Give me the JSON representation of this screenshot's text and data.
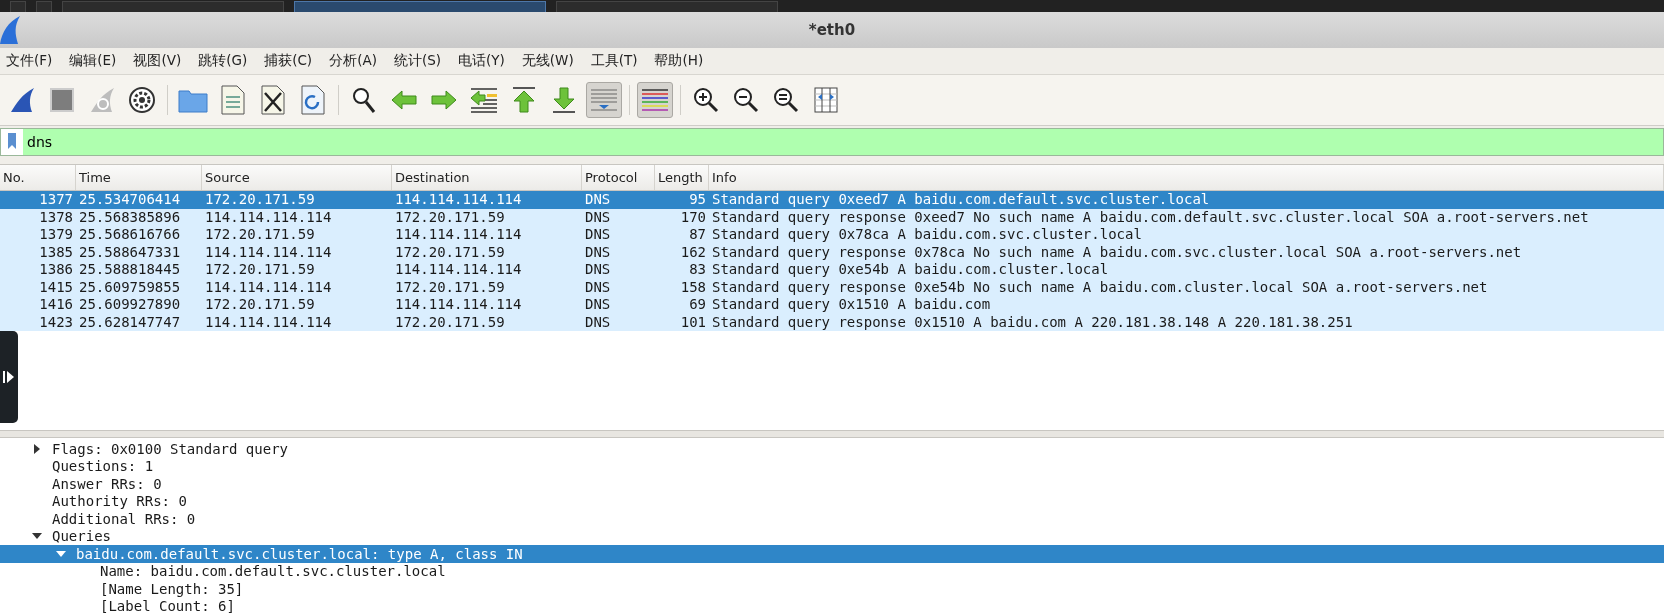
{
  "taskbar": [
    {
      "selected": false
    },
    {
      "selected": false
    },
    {
      "selected": false
    },
    {
      "selected": true
    },
    {
      "selected": false
    }
  ],
  "window": {
    "title": "*eth0"
  },
  "menu": [
    "文件(F)",
    "编辑(E)",
    "视图(V)",
    "跳转(G)",
    "捕获(C)",
    "分析(A)",
    "统计(S)",
    "电话(Y)",
    "无线(W)",
    "工具(T)",
    "帮助(H)"
  ],
  "toolbar": [
    {
      "kind": "button",
      "pressed": false
    },
    {
      "kind": "button",
      "pressed": false
    },
    {
      "kind": "button",
      "pressed": false
    },
    {
      "kind": "button",
      "pressed": false
    },
    {
      "kind": "separator"
    },
    {
      "kind": "button",
      "pressed": false
    },
    {
      "kind": "button",
      "pressed": false
    },
    {
      "kind": "button",
      "pressed": false
    },
    {
      "kind": "button",
      "pressed": false
    },
    {
      "kind": "separator"
    },
    {
      "kind": "button",
      "pressed": false
    },
    {
      "kind": "button",
      "pressed": false
    },
    {
      "kind": "button",
      "pressed": false
    },
    {
      "kind": "button",
      "pressed": false
    },
    {
      "kind": "button",
      "pressed": false
    },
    {
      "kind": "button",
      "pressed": false
    },
    {
      "kind": "button",
      "pressed": true
    },
    {
      "kind": "separator"
    },
    {
      "kind": "button",
      "pressed": true
    },
    {
      "kind": "separator"
    },
    {
      "kind": "button",
      "pressed": false
    },
    {
      "kind": "button",
      "pressed": false
    },
    {
      "kind": "button",
      "pressed": false
    },
    {
      "kind": "button",
      "pressed": false
    }
  ],
  "filter": {
    "value": "dns"
  },
  "packet_list": {
    "columns": [
      "No.",
      "Time",
      "Source",
      "Destination",
      "Protocol",
      "Length",
      "Info"
    ],
    "rows": [
      {
        "cells": [
          "1377",
          "25.534706414",
          "172.20.171.59",
          "114.114.114.114",
          "DNS",
          "95",
          "Standard query 0xeed7 A baidu.com.default.svc.cluster.local"
        ],
        "selected": true
      },
      {
        "cells": [
          "1378",
          "25.568385896",
          "114.114.114.114",
          "172.20.171.59",
          "DNS",
          "170",
          "Standard query response 0xeed7 No such name A baidu.com.default.svc.cluster.local SOA a.root-servers.net"
        ],
        "selected": false
      },
      {
        "cells": [
          "1379",
          "25.568616766",
          "172.20.171.59",
          "114.114.114.114",
          "DNS",
          "87",
          "Standard query 0x78ca A baidu.com.svc.cluster.local"
        ],
        "selected": false
      },
      {
        "cells": [
          "1385",
          "25.588647331",
          "114.114.114.114",
          "172.20.171.59",
          "DNS",
          "162",
          "Standard query response 0x78ca No such name A baidu.com.svc.cluster.local SOA a.root-servers.net"
        ],
        "selected": false
      },
      {
        "cells": [
          "1386",
          "25.588818445",
          "172.20.171.59",
          "114.114.114.114",
          "DNS",
          "83",
          "Standard query 0xe54b A baidu.com.cluster.local"
        ],
        "selected": false
      },
      {
        "cells": [
          "1415",
          "25.609759855",
          "114.114.114.114",
          "172.20.171.59",
          "DNS",
          "158",
          "Standard query response 0xe54b No such name A baidu.com.cluster.local SOA a.root-servers.net"
        ],
        "selected": false
      },
      {
        "cells": [
          "1416",
          "25.609927890",
          "172.20.171.59",
          "114.114.114.114",
          "DNS",
          "69",
          "Standard query 0x1510 A baidu.com"
        ],
        "selected": false
      },
      {
        "cells": [
          "1423",
          "25.628147747",
          "114.114.114.114",
          "172.20.171.59",
          "DNS",
          "101",
          "Standard query response 0x1510 A baidu.com A 220.181.38.148 A 220.181.38.251"
        ],
        "selected": false
      }
    ]
  },
  "details": [
    {
      "text": "Flags: 0x0100 Standard query",
      "expanded": false,
      "selected": false
    },
    {
      "text": "Questions: 1",
      "selected": false
    },
    {
      "text": "Answer RRs: 0",
      "selected": false
    },
    {
      "text": "Authority RRs: 0",
      "selected": false
    },
    {
      "text": "Additional RRs: 0",
      "selected": false
    },
    {
      "text": "Queries",
      "expanded": true,
      "selected": false,
      "children": [
        {
          "text": "baidu.com.default.svc.cluster.local: type A, class IN",
          "expanded": true,
          "selected": true,
          "children": [
            {
              "text": "Name: baidu.com.default.svc.cluster.local",
              "selected": false
            },
            {
              "text": "[Name Length: 35]",
              "selected": false
            },
            {
              "text": "[Label Count: 6]",
              "selected": false
            }
          ]
        }
      ]
    }
  ]
}
